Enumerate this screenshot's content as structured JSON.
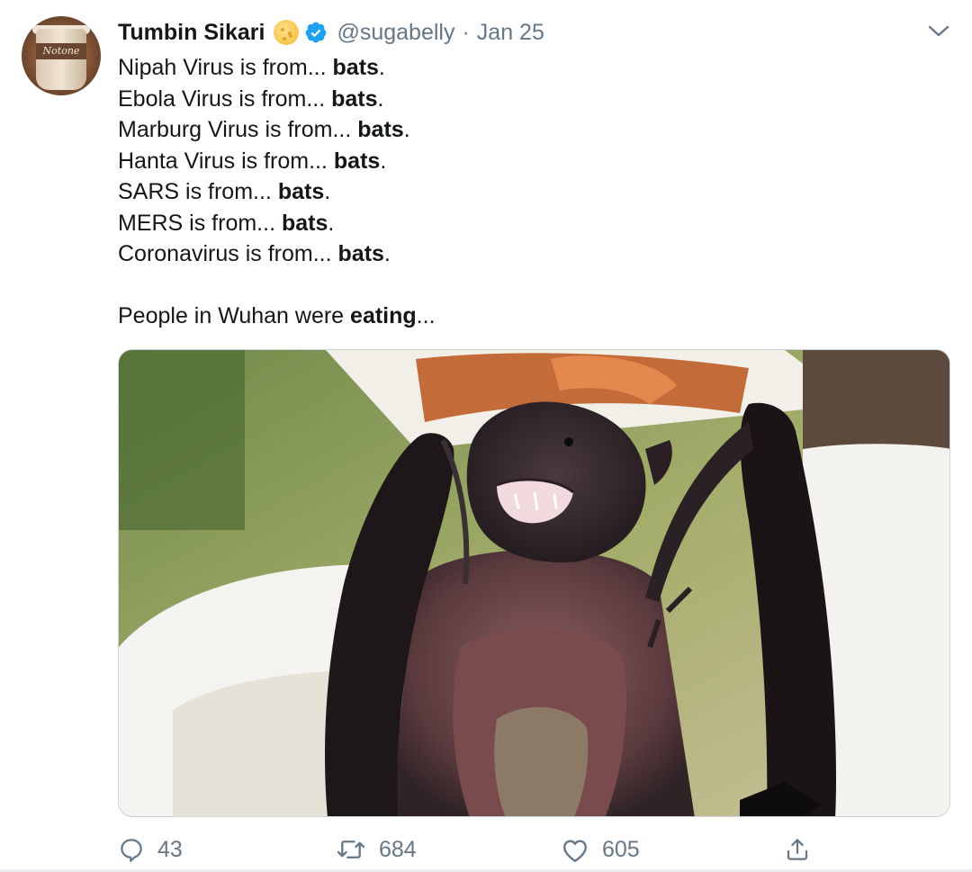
{
  "tweet": {
    "display_name": "Tumbin Sikari",
    "handle": "@sugabelly",
    "separator": "·",
    "date": "Jan 25",
    "lines": [
      {
        "prefix": "Nipah Virus is from... ",
        "bold": "bats",
        "suffix": "."
      },
      {
        "prefix": "Ebola Virus is from... ",
        "bold": "bats",
        "suffix": "."
      },
      {
        "prefix": "Marburg Virus is from... ",
        "bold": "bats",
        "suffix": "."
      },
      {
        "prefix": "Hanta Virus is from... ",
        "bold": "bats",
        "suffix": "."
      },
      {
        "prefix": "SARS is from... ",
        "bold": "bats",
        "suffix": "."
      },
      {
        "prefix": "MERS is from... ",
        "bold": "bats",
        "suffix": "."
      },
      {
        "prefix": "Coronavirus is from... ",
        "bold": "bats",
        "suffix": "."
      }
    ],
    "closing_line": {
      "prefix": "People in Wuhan were ",
      "bold": "eating",
      "suffix": "..."
    },
    "avatar_text": "Notone",
    "icons": {
      "name_emoji": "cookie-emoji-icon",
      "verified": "verified-badge-icon",
      "menu": "chevron-down-icon",
      "reply": "reply-icon",
      "retweet": "retweet-icon",
      "like": "heart-icon",
      "share": "share-icon"
    }
  },
  "actions": {
    "reply_count": "43",
    "retweet_count": "684",
    "like_count": "605"
  },
  "colors": {
    "text": "#14171a",
    "secondary": "#657786",
    "verified": "#1da1f2",
    "border": "#ccd6dd"
  }
}
